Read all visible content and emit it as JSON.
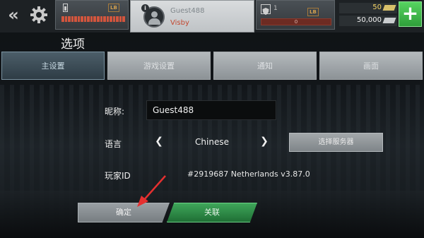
{
  "top_bar": {
    "back_icon": "double-chevron-left-icon",
    "settings_icon": "gear-icon",
    "status_badge": "LB",
    "player": {
      "name": "Guest488",
      "ship": "Visby"
    },
    "level": "1",
    "level_badge": "LB",
    "xp_value": "0",
    "gold": "50",
    "silver": "50,000",
    "add_label": "+"
  },
  "page": {
    "title": "选项"
  },
  "tabs": [
    {
      "label": "主设置",
      "active": true
    },
    {
      "label": "游戏设置",
      "active": false
    },
    {
      "label": "通知",
      "active": false
    },
    {
      "label": "画面",
      "active": false
    }
  ],
  "form": {
    "nickname_label": "昵称:",
    "nickname_value": "Guest488",
    "language_label": "语言",
    "language_prev": "❮",
    "language_value": "Chinese",
    "language_next": "❯",
    "select_server_label": "选择服务器",
    "player_id_label": "玩家ID",
    "player_id_value": "#2919687 Netherlands v3.87.0"
  },
  "buttons": {
    "confirm": "确定",
    "link": "关联"
  },
  "colors": {
    "accent_green": "#3fa65a",
    "hp_red": "#d2553d",
    "annotation_red": "#e53030"
  }
}
